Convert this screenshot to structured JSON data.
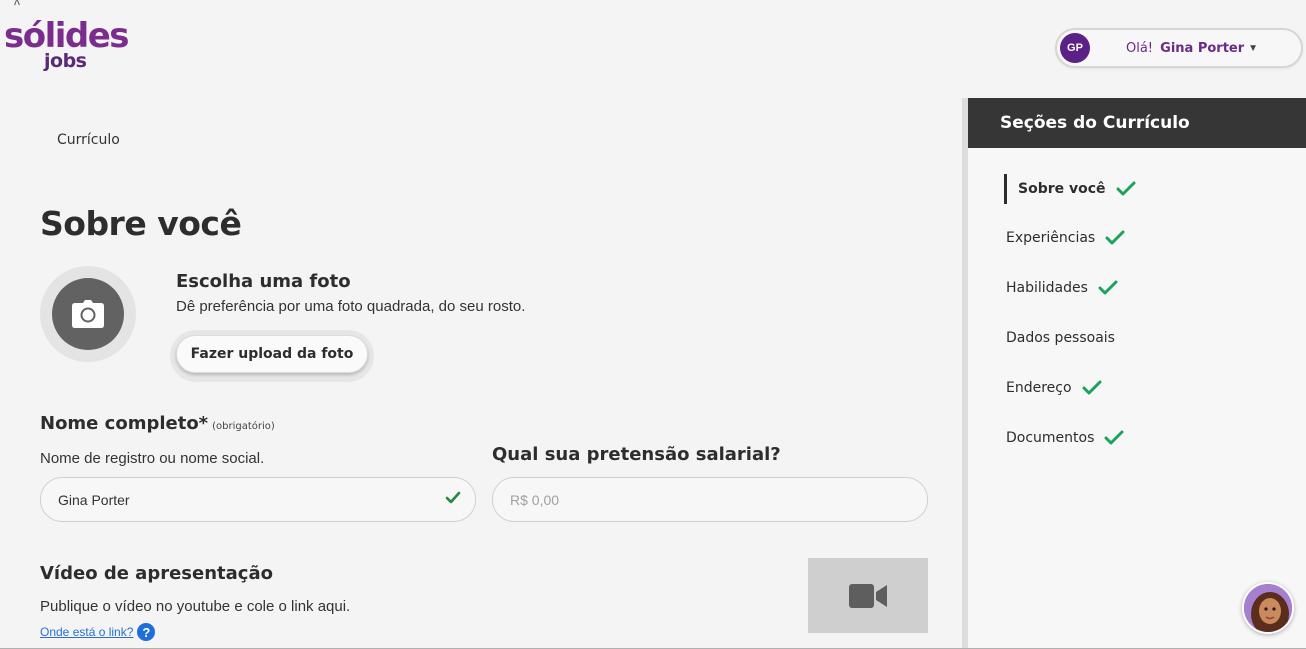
{
  "header": {
    "logo_main": "sólides",
    "logo_sub": "jobs",
    "user": {
      "initials": "GP",
      "greeting": "Olá!",
      "name": "Gina Porter"
    }
  },
  "breadcrumb": "Currículo",
  "page_title": "Sobre você",
  "photo": {
    "title": "Escolha uma foto",
    "description": "Dê preferência por uma foto quadrada, do seu rosto.",
    "upload_label": "Fazer upload da foto"
  },
  "name_field": {
    "title": "Nome completo*",
    "required_note": "(obrigatório)",
    "description": "Nome de registro ou nome social.",
    "value": "Gina Porter"
  },
  "salary_field": {
    "title": "Qual sua pretensão salarial?",
    "placeholder": "R$ 0,00"
  },
  "video": {
    "title": "Vídeo de apresentação",
    "description": "Publique o vídeo no youtube e cole o link aqui.",
    "help_link": "Onde está o link?",
    "help_icon": "?"
  },
  "sidebar": {
    "title": "Seções do Currículo",
    "items": [
      {
        "label": "Sobre você",
        "done": true,
        "active": true
      },
      {
        "label": "Experiências",
        "done": true,
        "active": false
      },
      {
        "label": "Habilidades",
        "done": true,
        "active": false
      },
      {
        "label": "Dados pessoais",
        "done": false,
        "active": false
      },
      {
        "label": "Endereço",
        "done": true,
        "active": false
      },
      {
        "label": "Documentos",
        "done": true,
        "active": false
      }
    ]
  },
  "colors": {
    "brand_purple": "#7b2d8e",
    "check_green": "#1aa35a",
    "sidebar_header": "#363636",
    "link_blue": "#2a6fd6"
  }
}
